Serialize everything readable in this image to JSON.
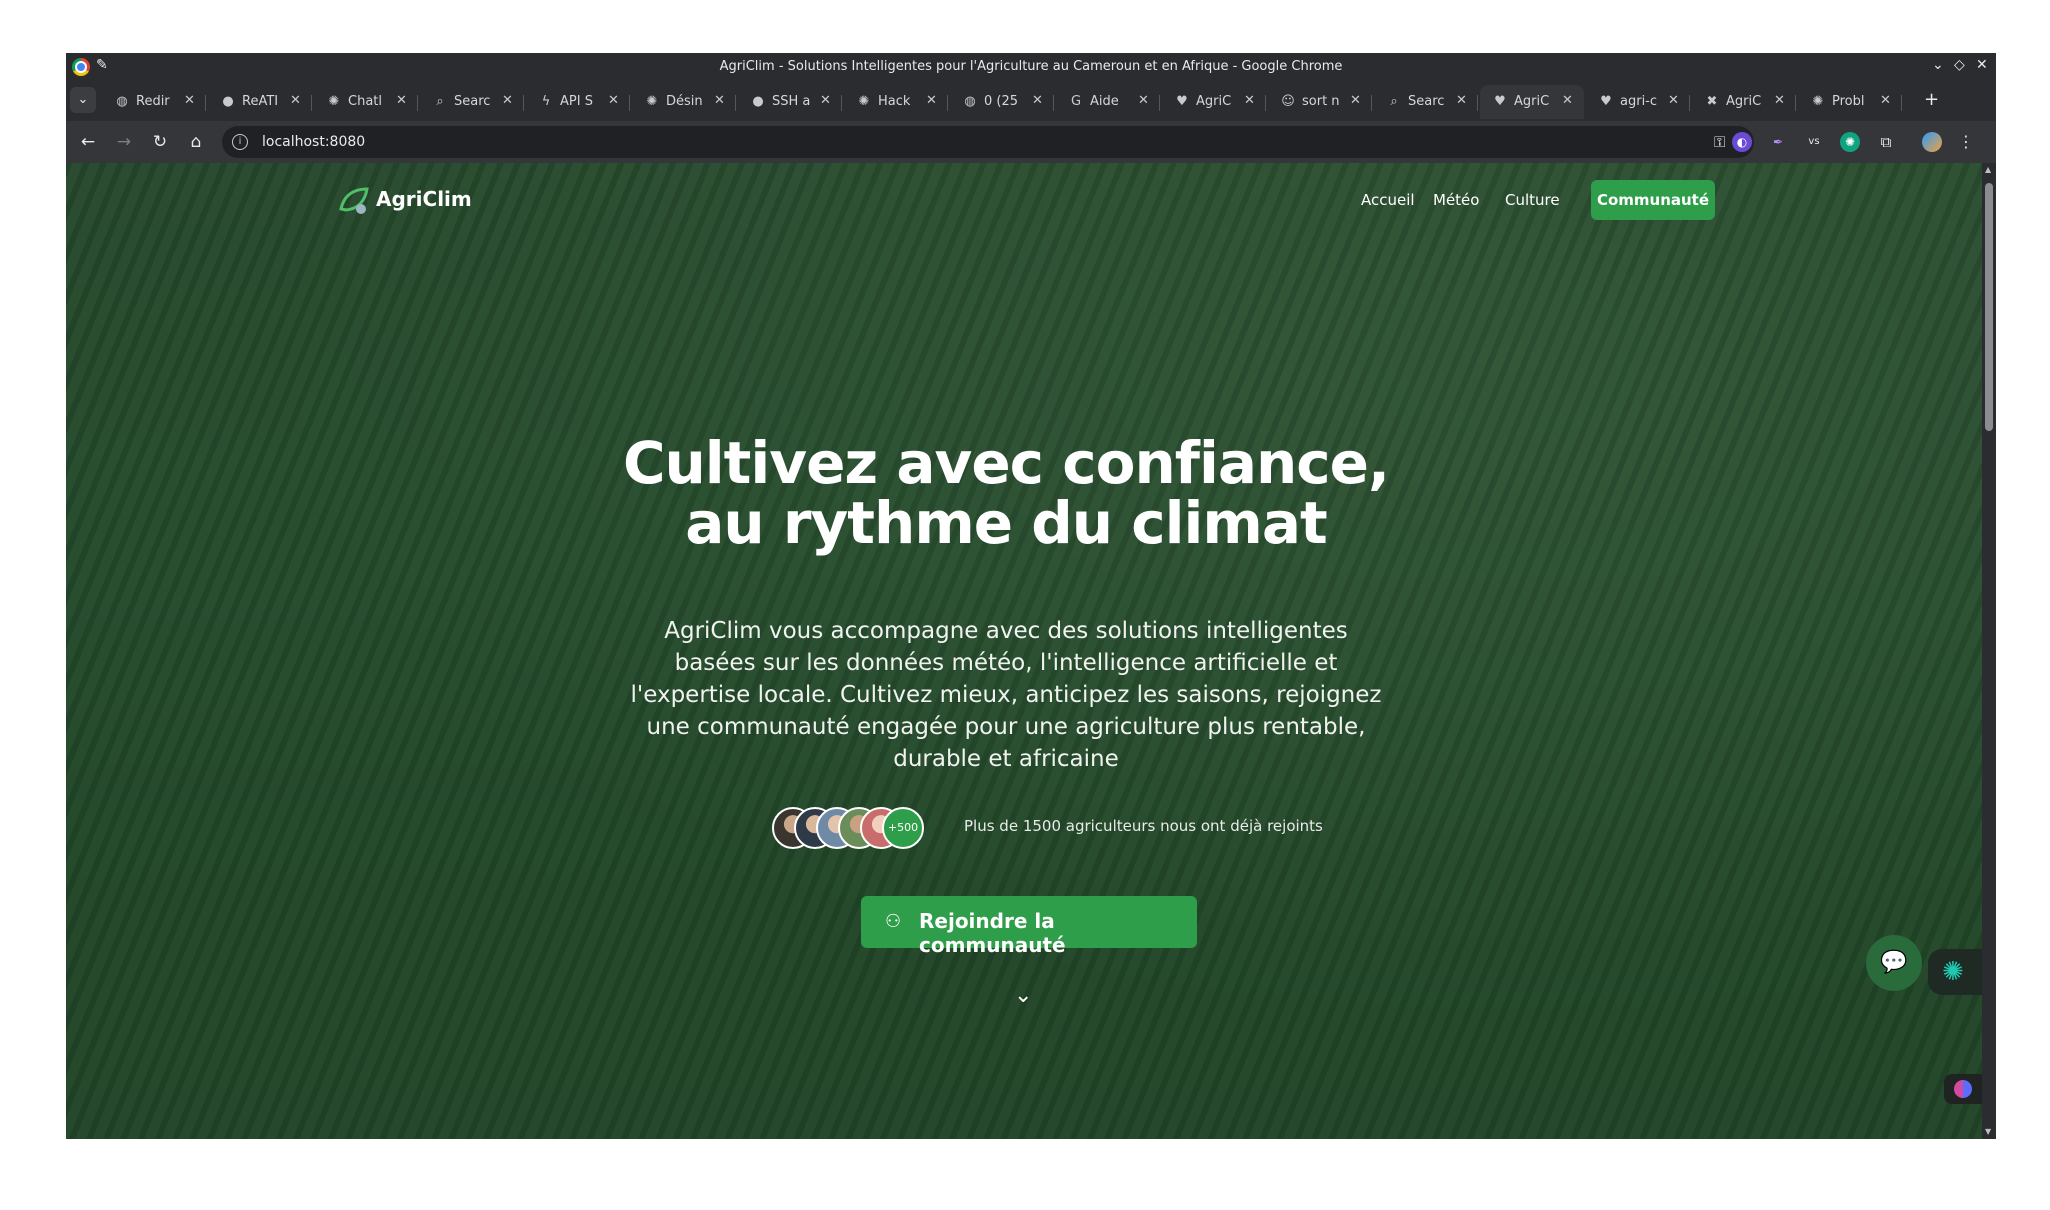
{
  "browser": {
    "window_title": "AgriClim - Solutions Intelligentes pour l'Agriculture au Cameroun et en Afrique - Google Chrome",
    "tabs": [
      {
        "label": "Redir",
        "icon": "globe-icon"
      },
      {
        "label": "ReATI",
        "icon": "github-icon"
      },
      {
        "label": "Chatl",
        "icon": "openai-icon"
      },
      {
        "label": "Searc",
        "icon": "search-icon"
      },
      {
        "label": "API S",
        "icon": "bolt-icon"
      },
      {
        "label": "Désin",
        "icon": "openai-icon"
      },
      {
        "label": "SSH a",
        "icon": "github-icon"
      },
      {
        "label": "Hack",
        "icon": "openai-icon"
      },
      {
        "label": "0 (25",
        "icon": "globe-icon"
      },
      {
        "label": "Aide",
        "icon": "google-icon"
      },
      {
        "label": "AgriC",
        "icon": "heart-icon"
      },
      {
        "label": "sort n",
        "icon": "ghost-icon"
      },
      {
        "label": "Searc",
        "icon": "search-icon"
      },
      {
        "label": "AgriC",
        "icon": "heart-icon",
        "active": true
      },
      {
        "label": "agri-c",
        "icon": "heart-icon"
      },
      {
        "label": "AgriC",
        "icon": "bug-icon"
      },
      {
        "label": "Probl",
        "icon": "openai-icon"
      }
    ],
    "url": "localhost:8080"
  },
  "site": {
    "brand": "AgriClim",
    "nav": {
      "home": "Accueil",
      "weather": "Météo",
      "crop": "Culture",
      "community": "Communauté"
    },
    "hero": {
      "title": "Cultivez avec confiance, au rythme du climat",
      "subtitle": "AgriClim vous accompagne avec des solutions intelligentes basées sur les données météo, l'intelligence artificielle et l'expertise locale. Cultivez mieux, anticipez les saisons, rejoignez une communauté engagée pour une agriculture plus rentable, durable et africaine",
      "avatar_more": "+500",
      "social_proof": "Plus de 1500 agriculteurs nous ont déjà rejoints",
      "cta": "Rejoindre la communauté"
    }
  },
  "colors": {
    "accent": "#2f9e4a",
    "hero_overlay": "#2c5733"
  }
}
